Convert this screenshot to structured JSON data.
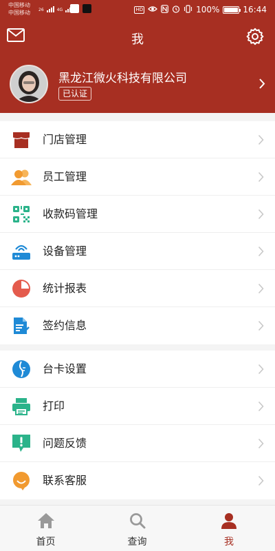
{
  "status_bar": {
    "carrier_1": "中国移动",
    "carrier_2": "中国移动",
    "network_1": "26",
    "network_2": "4G",
    "battery_percent": "100%",
    "battery_level": 1.0,
    "time": "16:44",
    "hd_label": "HD"
  },
  "header": {
    "title": "我",
    "left_icon": "mail-icon",
    "right_icon": "gear-icon"
  },
  "profile": {
    "company_name": "黑龙江微火科技有限公司",
    "verified_label": "已认证"
  },
  "menu_group_1": [
    {
      "label": "门店管理",
      "icon": "store-icon",
      "color": "#a72f22"
    },
    {
      "label": "员工管理",
      "icon": "staff-icon",
      "color": "#f19a30"
    },
    {
      "label": "收款码管理",
      "icon": "qrcode-icon",
      "color": "#2bb38a"
    },
    {
      "label": "设备管理",
      "icon": "router-icon",
      "color": "#1f8ad6"
    },
    {
      "label": "统计报表",
      "icon": "pie-chart-icon",
      "color": "#e45b4d"
    },
    {
      "label": "签约信息",
      "icon": "contract-icon",
      "color": "#1f8ad6"
    }
  ],
  "menu_group_2": [
    {
      "label": "台卡设置",
      "icon": "card-stand-icon",
      "color": "#1f8ad6"
    },
    {
      "label": "打印",
      "icon": "printer-icon",
      "color": "#2bb38a"
    },
    {
      "label": "问题反馈",
      "icon": "feedback-icon",
      "color": "#2bb38a"
    },
    {
      "label": "联系客服",
      "icon": "customer-service-icon",
      "color": "#f19a30"
    }
  ],
  "tabbar": [
    {
      "label": "首页",
      "icon": "home-icon",
      "active": false
    },
    {
      "label": "查询",
      "icon": "search-icon",
      "active": false
    },
    {
      "label": "我",
      "icon": "user-icon",
      "active": true
    }
  ],
  "colors": {
    "primary": "#a72f22",
    "tab_inactive": "#999999",
    "tab_active": "#a72f22",
    "chevron": "#c8c8c8"
  }
}
